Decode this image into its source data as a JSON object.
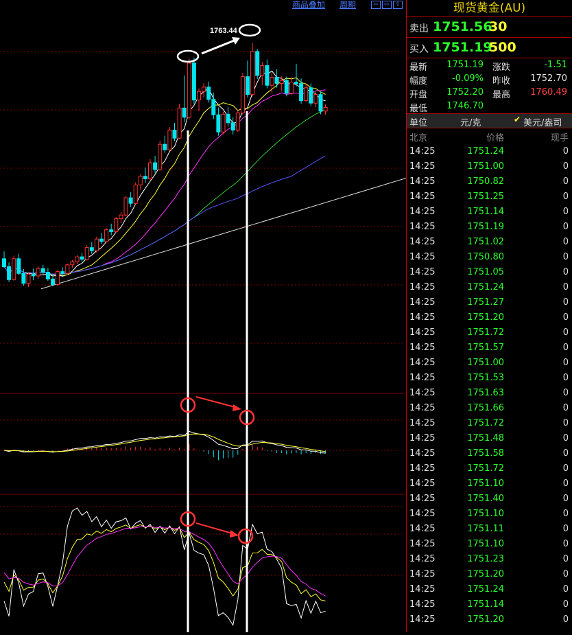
{
  "topbar": {
    "overlay_label": "商品叠加",
    "period_label": "周期",
    "nav_left": "⇦",
    "nav_right": "⇨",
    "nav_up": "⇧"
  },
  "annotation": {
    "high_label": "1763.44"
  },
  "panel": {
    "title": "现货黄金(AU)",
    "sell": {
      "label": "卖出",
      "price": "1751.56",
      "volume": "30"
    },
    "buy": {
      "label": "买入",
      "price": "1751.19",
      "volume": "500"
    },
    "stats": {
      "latest_label": "最新",
      "latest": "1751.19",
      "change_label": "涨跌",
      "change": "-1.51",
      "pct_label": "幅度",
      "pct": "-0.09%",
      "prev_label": "昨收",
      "prev": "1752.70",
      "open_label": "开盘",
      "open": "1752.20",
      "high_label": "最高",
      "high": "1760.49",
      "low_label": "最低",
      "low": "1746.70"
    },
    "unit_label": "单位",
    "unit": "元/克",
    "usd_unit": "美元/盎司",
    "header": {
      "time": "北京",
      "price": "价格",
      "volume": "现手"
    },
    "ticks": [
      {
        "time": "14:25",
        "price": "1751.24",
        "vol": "0"
      },
      {
        "time": "14:25",
        "price": "1751.00",
        "vol": "0"
      },
      {
        "time": "14:25",
        "price": "1750.82",
        "vol": "0"
      },
      {
        "time": "14:25",
        "price": "1751.25",
        "vol": "0"
      },
      {
        "time": "14:25",
        "price": "1751.14",
        "vol": "0"
      },
      {
        "time": "14:25",
        "price": "1751.19",
        "vol": "0"
      },
      {
        "time": "14:25",
        "price": "1751.02",
        "vol": "0"
      },
      {
        "time": "14:25",
        "price": "1750.80",
        "vol": "0"
      },
      {
        "time": "14:25",
        "price": "1751.05",
        "vol": "0"
      },
      {
        "time": "14:25",
        "price": "1751.24",
        "vol": "0"
      },
      {
        "time": "14:25",
        "price": "1751.27",
        "vol": "0"
      },
      {
        "time": "14:25",
        "price": "1751.20",
        "vol": "0"
      },
      {
        "time": "14:25",
        "price": "1751.72",
        "vol": "0"
      },
      {
        "time": "14:25",
        "price": "1751.57",
        "vol": "0"
      },
      {
        "time": "14:25",
        "price": "1751.00",
        "vol": "0"
      },
      {
        "time": "14:25",
        "price": "1751.53",
        "vol": "0"
      },
      {
        "time": "14:25",
        "price": "1751.63",
        "vol": "0"
      },
      {
        "time": "14:25",
        "price": "1751.66",
        "vol": "0"
      },
      {
        "time": "14:25",
        "price": "1751.72",
        "vol": "0"
      },
      {
        "time": "14:25",
        "price": "1751.48",
        "vol": "0"
      },
      {
        "time": "14:25",
        "price": "1751.58",
        "vol": "0"
      },
      {
        "time": "14:25",
        "price": "1751.72",
        "vol": "0"
      },
      {
        "time": "14:25",
        "price": "1751.10",
        "vol": "0"
      },
      {
        "time": "14:25",
        "price": "1751.40",
        "vol": "0"
      },
      {
        "time": "14:25",
        "price": "1751.10",
        "vol": "0"
      },
      {
        "time": "14:25",
        "price": "1751.11",
        "vol": "0"
      },
      {
        "time": "14:25",
        "price": "1751.10",
        "vol": "0"
      },
      {
        "time": "14:25",
        "price": "1751.23",
        "vol": "0"
      },
      {
        "time": "14:25",
        "price": "1751.20",
        "vol": "0"
      },
      {
        "time": "14:25",
        "price": "1751.24",
        "vol": "0"
      },
      {
        "time": "14:25",
        "price": "1751.14",
        "vol": "0"
      },
      {
        "time": "14:25",
        "price": "1751.20",
        "vol": "0"
      }
    ]
  },
  "colors": {
    "up": "#ff3333",
    "down": "#00e5ee",
    "ma5": "#ffffff",
    "ma10": "#ffff33",
    "ma20": "#ff33ff",
    "ma40": "#33cc33",
    "ma60": "#5555ff",
    "grid": "#7a0000",
    "annot_red": "#ff3333",
    "annot_white": "#ffffff"
  },
  "chart_data": {
    "type": "candlestick",
    "candles": [
      [
        1728.4,
        1729.6,
        1726.9,
        1727.1
      ],
      [
        1727.1,
        1727.8,
        1724.6,
        1725.0
      ],
      [
        1725.0,
        1728.9,
        1724.8,
        1728.4
      ],
      [
        1728.4,
        1729.2,
        1725.7,
        1726.0
      ],
      [
        1726.0,
        1726.7,
        1724.0,
        1724.4
      ],
      [
        1724.4,
        1726.2,
        1723.8,
        1725.9
      ],
      [
        1725.9,
        1726.8,
        1724.9,
        1725.6
      ],
      [
        1725.6,
        1727.2,
        1725.1,
        1726.8
      ],
      [
        1726.8,
        1727.4,
        1725.9,
        1726.2
      ],
      [
        1726.2,
        1726.9,
        1724.8,
        1725.1
      ],
      [
        1725.1,
        1725.8,
        1723.9,
        1724.2
      ],
      [
        1724.2,
        1726.6,
        1724.0,
        1726.3
      ],
      [
        1726.3,
        1727.0,
        1725.6,
        1726.0
      ],
      [
        1726.0,
        1727.6,
        1725.8,
        1727.4
      ],
      [
        1727.4,
        1728.2,
        1726.9,
        1727.9
      ],
      [
        1727.9,
        1729.0,
        1727.5,
        1728.7
      ],
      [
        1728.7,
        1729.4,
        1727.9,
        1728.3
      ],
      [
        1728.3,
        1730.6,
        1728.1,
        1730.2
      ],
      [
        1730.2,
        1731.1,
        1729.2,
        1729.7
      ],
      [
        1729.7,
        1732.0,
        1729.4,
        1731.6
      ],
      [
        1731.6,
        1732.6,
        1730.8,
        1731.2
      ],
      [
        1731.2,
        1733.4,
        1731.0,
        1733.1
      ],
      [
        1733.1,
        1734.1,
        1732.2,
        1732.8
      ],
      [
        1732.8,
        1735.2,
        1732.6,
        1734.9
      ],
      [
        1734.9,
        1736.0,
        1734.2,
        1735.5
      ],
      [
        1735.5,
        1738.6,
        1735.3,
        1738.3
      ],
      [
        1738.3,
        1739.2,
        1736.8,
        1737.4
      ],
      [
        1737.4,
        1740.8,
        1737.2,
        1740.4
      ],
      [
        1740.4,
        1742.2,
        1739.6,
        1741.8
      ],
      [
        1741.8,
        1743.2,
        1740.7,
        1741.4
      ],
      [
        1741.4,
        1744.6,
        1741.2,
        1744.0
      ],
      [
        1744.0,
        1745.1,
        1742.3,
        1742.9
      ],
      [
        1742.9,
        1747.6,
        1742.7,
        1747.0
      ],
      [
        1747.0,
        1748.4,
        1745.6,
        1746.1
      ],
      [
        1746.1,
        1749.8,
        1745.9,
        1749.3
      ],
      [
        1749.3,
        1750.5,
        1747.5,
        1748.0
      ],
      [
        1748.0,
        1753.6,
        1747.8,
        1752.9
      ],
      [
        1752.9,
        1758.2,
        1750.6,
        1751.4
      ],
      [
        1751.4,
        1760.9,
        1751.0,
        1760.2
      ],
      [
        1760.2,
        1761.1,
        1753.6,
        1754.2
      ],
      [
        1754.2,
        1756.1,
        1752.4,
        1755.6
      ],
      [
        1755.6,
        1757.0,
        1754.6,
        1756.3
      ],
      [
        1756.3,
        1757.2,
        1753.8,
        1754.3
      ],
      [
        1754.3,
        1755.4,
        1751.1,
        1751.8
      ],
      [
        1751.8,
        1753.0,
        1748.4,
        1749.0
      ],
      [
        1749.0,
        1752.3,
        1748.6,
        1751.9
      ],
      [
        1751.9,
        1753.1,
        1749.9,
        1750.5
      ],
      [
        1750.5,
        1751.4,
        1748.6,
        1749.3
      ],
      [
        1749.3,
        1752.5,
        1749.0,
        1752.1
      ],
      [
        1752.1,
        1758.6,
        1751.8,
        1758.0
      ],
      [
        1758.0,
        1760.6,
        1754.6,
        1755.1
      ],
      [
        1755.1,
        1763.44,
        1754.8,
        1762.1
      ],
      [
        1762.1,
        1762.5,
        1757.6,
        1758.2
      ],
      [
        1758.2,
        1760.4,
        1756.6,
        1759.8
      ],
      [
        1759.8,
        1760.8,
        1756.1,
        1756.6
      ],
      [
        1756.6,
        1758.7,
        1755.3,
        1757.9
      ],
      [
        1757.9,
        1759.2,
        1756.2,
        1756.9
      ],
      [
        1756.9,
        1758.1,
        1755.6,
        1757.4
      ],
      [
        1757.4,
        1758.0,
        1754.8,
        1755.3
      ],
      [
        1755.3,
        1757.9,
        1755.0,
        1757.1
      ],
      [
        1757.1,
        1760.1,
        1756.4,
        1756.9
      ],
      [
        1756.9,
        1757.7,
        1753.6,
        1754.1
      ],
      [
        1754.1,
        1756.8,
        1753.9,
        1756.2
      ],
      [
        1756.2,
        1756.9,
        1753.2,
        1753.7
      ],
      [
        1753.7,
        1755.6,
        1753.0,
        1755.1
      ],
      [
        1755.1,
        1755.6,
        1751.9,
        1752.4
      ],
      [
        1752.4,
        1753.5,
        1751.8,
        1753.0
      ]
    ],
    "annotations": [
      "1763.44"
    ]
  }
}
